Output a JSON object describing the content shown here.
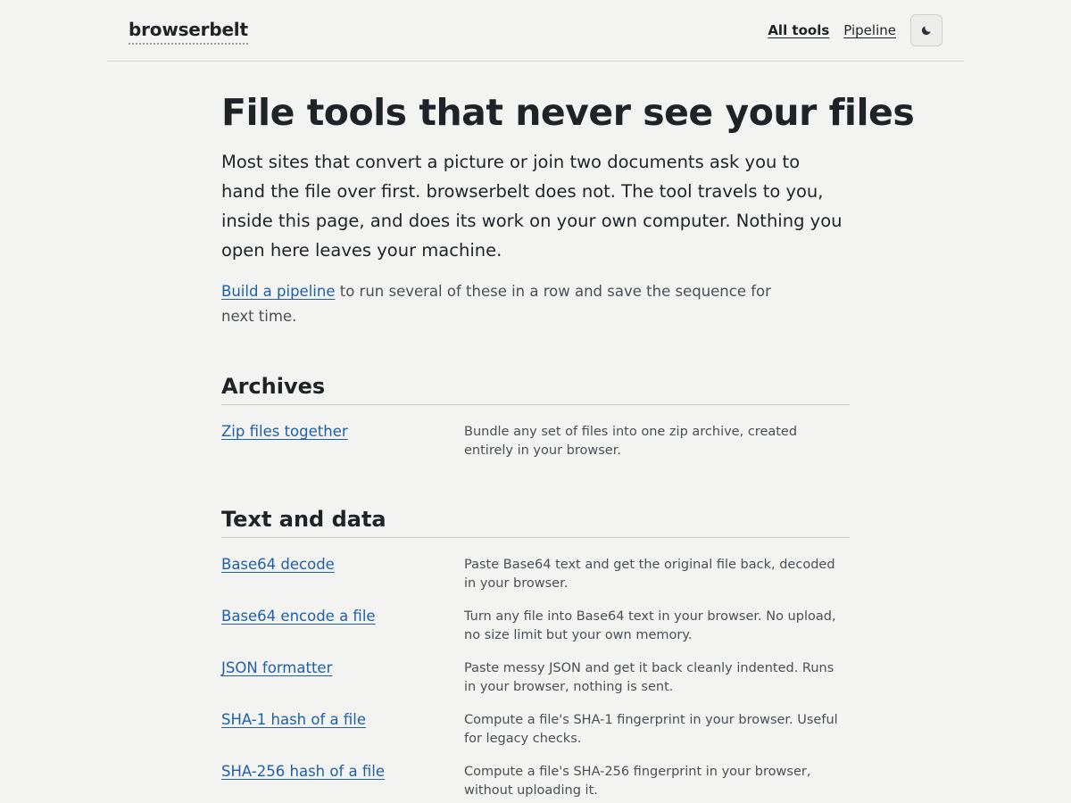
{
  "header": {
    "brand": "browserbelt",
    "nav": [
      {
        "label": "All tools",
        "active": true
      },
      {
        "label": "Pipeline",
        "active": false
      }
    ],
    "theme_toggle_icon": "moon-icon"
  },
  "hero": {
    "title": "File tools that never see your files",
    "lede": "Most sites that convert a picture or join two documents ask you to hand the file over first. browserbelt does not. The tool travels to you, inside this page, and does its work on your own computer. Nothing you open here leaves your machine.",
    "note_link": "Build a pipeline",
    "note_text": " to run several of these in a row and save the sequence for next time."
  },
  "sections": [
    {
      "title": "Archives",
      "tools": [
        {
          "name": "Zip files together",
          "desc": "Bundle any set of files into one zip archive, created entirely in your browser."
        }
      ]
    },
    {
      "title": "Text and data",
      "tools": [
        {
          "name": "Base64 decode",
          "desc": "Paste Base64 text and get the original file back, decoded in your browser."
        },
        {
          "name": "Base64 encode a file",
          "desc": "Turn any file into Base64 text in your browser. No upload, no size limit but your own memory."
        },
        {
          "name": "JSON formatter",
          "desc": "Paste messy JSON and get it back cleanly indented. Runs in your browser, nothing is sent."
        },
        {
          "name": "SHA-1 hash of a file",
          "desc": "Compute a file's SHA-1 fingerprint in your browser. Useful for legacy checks."
        },
        {
          "name": "SHA-256 hash of a file",
          "desc": "Compute a file's SHA-256 fingerprint in your browser, without uploading it."
        }
      ]
    }
  ]
}
